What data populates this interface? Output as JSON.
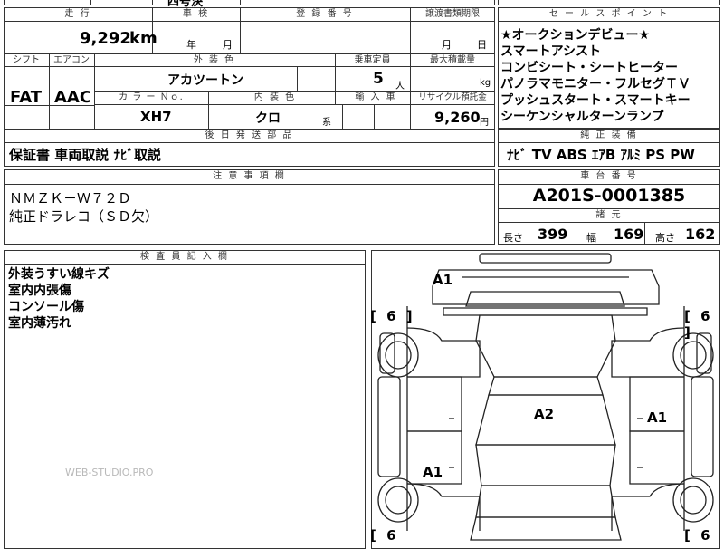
{
  "top_partial": {
    "cut_text": "四号決"
  },
  "headers": {
    "mileage": "走 行",
    "inspection": "車 検",
    "registration": "登 録 番 号",
    "transfer_deadline": "譲渡書類期限",
    "shift": "シフト",
    "aircon": "エアコン",
    "exterior_color": "外 装 色",
    "capacity": "乗車定員",
    "max_load": "最大積載量",
    "color_no": "カ ラ ー Ｎｏ.",
    "interior_color": "内 装 色",
    "import": "輸 入 車",
    "recycle_fee": "リサイクル預託金",
    "later_parts": "後 日 発 送 部 品",
    "notes": "注 意 事 項 欄",
    "inspector": "検 査 員 記 入 欄",
    "sales_points": "セ ー ル ス ポ イ ン ト",
    "genuine_equipment": "純 正 装 備",
    "chassis_no": "車 台 番 号",
    "specs": "諸 元"
  },
  "values": {
    "mileage": "9,292",
    "mileage_unit": "km",
    "inspection_year": "年",
    "inspection_month": "月",
    "transfer_month": "月",
    "transfer_day": "日",
    "shift": "FAT",
    "aircon": "AAC",
    "exterior_color": "アカツートン",
    "capacity": "5",
    "capacity_unit": "人",
    "max_load_unit": "kg",
    "color_no": "XH7",
    "interior_color": "クロ",
    "interior_suffix": "系",
    "recycle_fee": "9,260",
    "recycle_unit": "円",
    "later_parts": "保証書 車両取説 ﾅﾋﾞ取説",
    "notes_line1": "ＮＭＺＫ－Ｗ７２Ｄ",
    "notes_line2": "純正ドラレコ（ＳＤ欠）",
    "chassis_no": "A201S-0001385",
    "length_label": "長さ",
    "length": "399",
    "width_label": "幅",
    "width": "169",
    "height_label": "高さ",
    "height": "162"
  },
  "sales_points": [
    "★オークションデビュー★",
    "スマートアシスト",
    "コンビシート・シートヒーター",
    "パノラマモニター・フルセグＴＶ",
    "プッシュスタート・スマートキー",
    "シーケンシャルターンランプ"
  ],
  "equipment": "ﾅﾋﾞ TV ABS ｴｱB ｱﾙﾐ PS PW",
  "inspector_notes": [
    "外装うすい線キズ",
    "室内内張傷",
    "コンソール傷",
    "室内薄汚れ"
  ],
  "diagram": {
    "labels": {
      "a1_top": "A1",
      "a2_center": "A2",
      "a1_right": "A1",
      "a1_left": "A1"
    },
    "tread": {
      "fl": "[ 6 ]",
      "fr": "[ 6 ]",
      "rl": "[ 6",
      "rr": "[ 6"
    }
  },
  "watermark": "WEB-STUDIO.PRO"
}
